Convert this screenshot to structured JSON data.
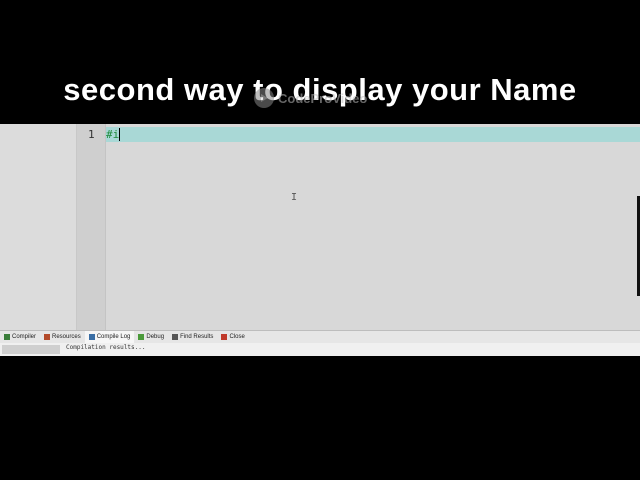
{
  "caption": {
    "text": "second way to display your Name"
  },
  "watermark": {
    "text": "CodeProVideo"
  },
  "editor": {
    "line_number": "1",
    "code": "#i",
    "cursor_glyph": "I"
  },
  "bottom_tabs": [
    {
      "label": "Compiler",
      "icon": "compiler-grid-icon",
      "color": "#3a7d3a"
    },
    {
      "label": "Resources",
      "icon": "resources-icon",
      "color": "#b34a2a"
    },
    {
      "label": "Compile Log",
      "icon": "compile-log-icon",
      "color": "#3a6ea5",
      "active": true
    },
    {
      "label": "Debug",
      "icon": "debug-check-icon",
      "color": "#4a9a3a"
    },
    {
      "label": "Find Results",
      "icon": "find-results-icon",
      "color": "#555555"
    },
    {
      "label": "Close",
      "icon": "close-icon",
      "color": "#c0392b"
    }
  ],
  "log": {
    "text": "Compilation results..."
  },
  "colors": {
    "current_line": "#a9d8d6",
    "code_green": "#1f8a3a",
    "background": "#000000"
  }
}
